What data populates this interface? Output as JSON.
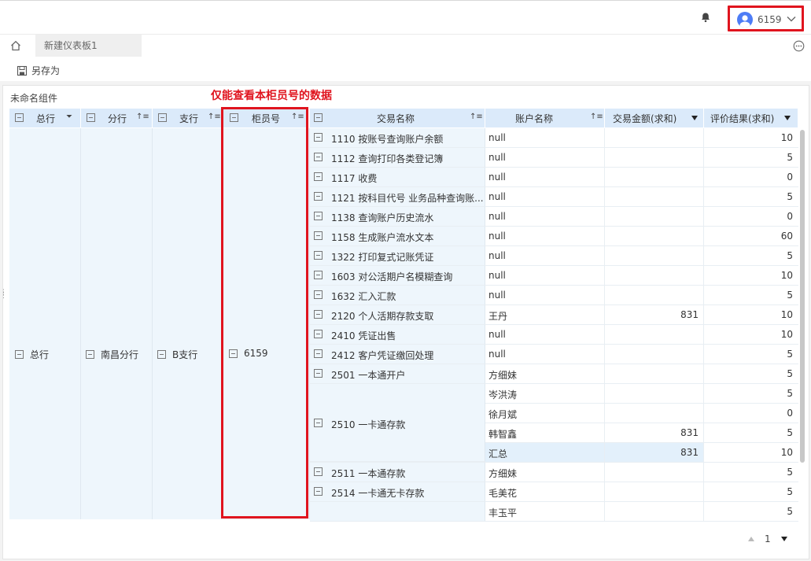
{
  "header": {
    "username": "6159"
  },
  "tabs": [
    {
      "label": "新建仪表板1"
    }
  ],
  "toolbar": {
    "save_as": "另存为"
  },
  "component": {
    "title": "未命名组件"
  },
  "annotation": "仅能查看本柜员号的数据",
  "columns": {
    "head_office": "总行",
    "branch": "分行",
    "sub_branch": "支行",
    "teller_id": "柜员号",
    "transaction_name": "交易名称",
    "account_name": "账户名称",
    "amount_sum": "交易金额(求和)",
    "rating_sum": "评价结果(求和)"
  },
  "merged": {
    "head_office": "总行",
    "branch": "南昌分行",
    "sub_branch": "B支行",
    "teller_id": "6159"
  },
  "rows": [
    {
      "transaction": "1110 按账号查询账户余额",
      "account": "null",
      "amount": "",
      "rating": "10"
    },
    {
      "transaction": "1112 查询打印各类登记簿",
      "account": "null",
      "amount": "",
      "rating": "5"
    },
    {
      "transaction": "1117 收费",
      "account": "null",
      "amount": "",
      "rating": "0"
    },
    {
      "transaction": "1121 按科目代号 业务品种查询账...",
      "account": "null",
      "amount": "",
      "rating": "5"
    },
    {
      "transaction": "1138 查询账户历史流水",
      "account": "null",
      "amount": "",
      "rating": "0"
    },
    {
      "transaction": "1158 生成账户流水文本",
      "account": "null",
      "amount": "",
      "rating": "60"
    },
    {
      "transaction": "1322 打印复式记账凭证",
      "account": "null",
      "amount": "",
      "rating": "5"
    },
    {
      "transaction": "1603 对公活期户名模糊查询",
      "account": "null",
      "amount": "",
      "rating": "10"
    },
    {
      "transaction": "1632 汇入汇款",
      "account": "null",
      "amount": "",
      "rating": "5"
    },
    {
      "transaction": "2120 个人活期存款支取",
      "account": "王丹",
      "amount": "831",
      "rating": "10"
    },
    {
      "transaction": "2410 凭证出售",
      "account": "null",
      "amount": "",
      "rating": "10"
    },
    {
      "transaction": "2412 客户凭证缴回处理",
      "account": "null",
      "amount": "",
      "rating": "5"
    },
    {
      "transaction": "2501 一本通开户",
      "account": "方细妹",
      "amount": "",
      "rating": "5"
    }
  ],
  "group_2510": {
    "transaction": "2510 一卡通存款",
    "sub_rows": [
      {
        "account": "岑洪涛",
        "amount": "",
        "rating": "5"
      },
      {
        "account": "徐月斌",
        "amount": "",
        "rating": "0"
      },
      {
        "account": "韩智鑫",
        "amount": "831",
        "rating": "5"
      },
      {
        "account": "汇总",
        "amount": "831",
        "rating": "10"
      }
    ]
  },
  "rows_after": [
    {
      "transaction": "2511 一本通存款",
      "account": "方细妹",
      "amount": "",
      "rating": "5"
    },
    {
      "transaction": "2514 一卡通无卡存款",
      "account": "毛美花",
      "amount": "",
      "rating": "5"
    },
    {
      "transaction": "",
      "account": "丰玉平",
      "amount": "",
      "rating": "5"
    }
  ],
  "pager": {
    "page": "1"
  }
}
